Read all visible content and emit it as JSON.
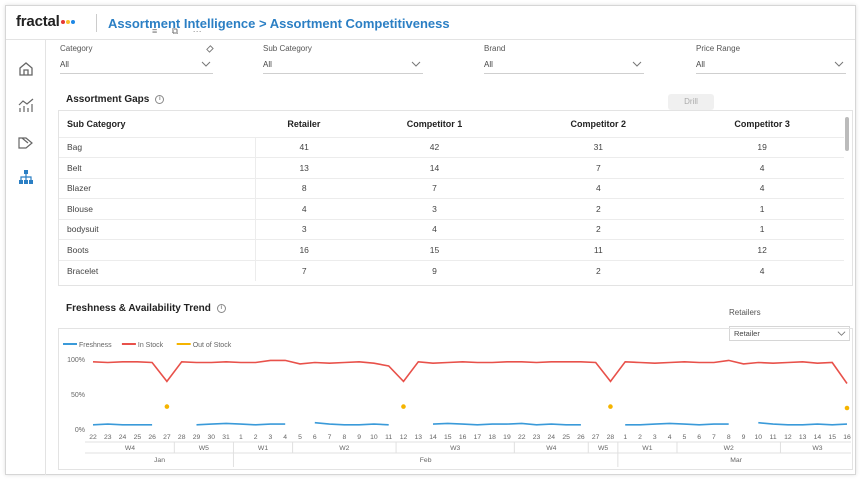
{
  "app": {
    "logo": "fractal",
    "logo_dot_colors": [
      "#e53935",
      "#fbc02d",
      "#1e88e5"
    ],
    "title": "Assortment Intelligence > Assortment Competitiveness"
  },
  "filters": [
    {
      "label": "Category",
      "value": "All"
    },
    {
      "label": "Sub Category",
      "value": "All"
    },
    {
      "label": "Brand",
      "value": "All"
    },
    {
      "label": "Price Range",
      "value": "All"
    }
  ],
  "gaps": {
    "title": "Assortment Gaps",
    "drill_label": "Drill",
    "columns": [
      "Sub Category",
      "Retailer",
      "Competitor 1",
      "Competitor 2",
      "Competitor 3"
    ],
    "rows": [
      [
        "Bag",
        "41",
        "42",
        "31",
        "19"
      ],
      [
        "Belt",
        "13",
        "14",
        "7",
        "4"
      ],
      [
        "Blazer",
        "8",
        "7",
        "4",
        "4"
      ],
      [
        "Blouse",
        "4",
        "3",
        "2",
        "1"
      ],
      [
        "bodysuit",
        "3",
        "4",
        "2",
        "1"
      ],
      [
        "Boots",
        "16",
        "15",
        "11",
        "12"
      ],
      [
        "Bracelet",
        "7",
        "9",
        "2",
        "4"
      ]
    ]
  },
  "trend": {
    "title": "Freshness & Availability Trend",
    "retailers_label": "Retailers",
    "retailer_value": "Retailer"
  },
  "colors": {
    "accent": "#2b7fc4",
    "freshness": "#3a9ad9",
    "in_stock": "#e8514a",
    "out_of_stock": "#f5b400"
  },
  "chart_data": {
    "type": "line",
    "legend": [
      "Freshness",
      "In Stock",
      "Out of Stock"
    ],
    "y_ticks": [
      "100%",
      "50%",
      "0%"
    ],
    "ylim": [
      0,
      100
    ],
    "x": [
      "22",
      "23",
      "24",
      "25",
      "26",
      "27",
      "28",
      "29",
      "30",
      "31",
      "1",
      "2",
      "3",
      "4",
      "5",
      "6",
      "7",
      "8",
      "9",
      "10",
      "11",
      "12",
      "13",
      "14",
      "15",
      "16",
      "17",
      "18",
      "19",
      "22",
      "23",
      "24",
      "25",
      "26",
      "27",
      "28",
      "1",
      "2",
      "3",
      "4",
      "5",
      "6",
      "7",
      "8",
      "9",
      "10",
      "11",
      "12",
      "13",
      "14",
      "15",
      "16"
    ],
    "weeks": [
      {
        "label": "W4",
        "from": 0,
        "to": 5
      },
      {
        "label": "W5",
        "from": 6,
        "to": 9
      },
      {
        "label": "W1",
        "from": 10,
        "to": 13
      },
      {
        "label": "W2",
        "from": 14,
        "to": 20
      },
      {
        "label": "W3",
        "from": 21,
        "to": 28
      },
      {
        "label": "W4",
        "from": 29,
        "to": 33
      },
      {
        "label": "W5",
        "from": 34,
        "to": 35
      },
      {
        "label": "W1",
        "from": 36,
        "to": 39
      },
      {
        "label": "W2",
        "from": 40,
        "to": 46
      },
      {
        "label": "W3",
        "from": 47,
        "to": 51
      }
    ],
    "months": [
      {
        "label": "Jan",
        "from": 0,
        "to": 9
      },
      {
        "label": "Feb",
        "from": 10,
        "to": 35
      },
      {
        "label": "Mar",
        "from": 36,
        "to": 51
      }
    ],
    "series": [
      {
        "name": "In Stock",
        "values": [
          96,
          95,
          96,
          96,
          95,
          68,
          96,
          95,
          95,
          96,
          95,
          95,
          98,
          98,
          93,
          95,
          94,
          95,
          96,
          94,
          90,
          68,
          96,
          94,
          95,
          96,
          95,
          95,
          96,
          96,
          95,
          96,
          96,
          96,
          95,
          68,
          96,
          95,
          94,
          95,
          96,
          95,
          95,
          98,
          93,
          95,
          94,
          95,
          96,
          94,
          95,
          65
        ]
      },
      {
        "name": "Freshness",
        "values": [
          6,
          7,
          6,
          6,
          6,
          null,
          null,
          6,
          7,
          8,
          7,
          6,
          7,
          7,
          null,
          9,
          7,
          6,
          6,
          7,
          6,
          null,
          null,
          7,
          8,
          7,
          6,
          7,
          7,
          8,
          6,
          7,
          6,
          6,
          null,
          null,
          6,
          6,
          7,
          8,
          7,
          6,
          7,
          7,
          null,
          9,
          7,
          6,
          6,
          7,
          6,
          7
        ]
      },
      {
        "name": "Out of Stock",
        "points": [
          {
            "x": 5,
            "y": 32
          },
          {
            "x": 21,
            "y": 32
          },
          {
            "x": 35,
            "y": 32
          },
          {
            "x": 51,
            "y": 30
          }
        ]
      }
    ]
  }
}
